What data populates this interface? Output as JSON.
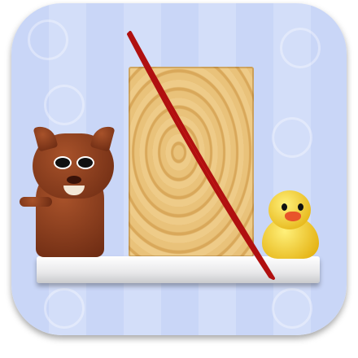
{
  "icon": {
    "name": "app-icon",
    "colors": {
      "background": "#c9d6f7",
      "wood": "#e0b468",
      "slash": "#d91e1e",
      "shelf": "#f2f2f4",
      "cat": "#8a3c1c",
      "chick": "#f5d21e"
    }
  }
}
